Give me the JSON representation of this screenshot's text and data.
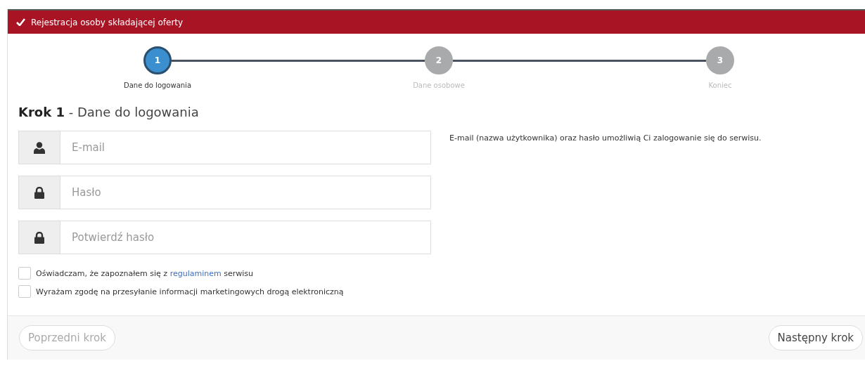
{
  "header": {
    "title": "Rejestracja osoby składającej oferty"
  },
  "steps": [
    {
      "number": "1",
      "label": "Dane do logowania",
      "selected": true
    },
    {
      "number": "2",
      "label": "Dane osobowe",
      "selected": false
    },
    {
      "number": "3",
      "label": "Koniec",
      "selected": false
    }
  ],
  "heading": {
    "step": "Krok 1",
    "title": " - Dane do logowania"
  },
  "fields": [
    {
      "kind": "user",
      "placeholder": "E-mail"
    },
    {
      "kind": "lock",
      "placeholder": "Hasło"
    },
    {
      "kind": "lock",
      "placeholder": "Potwierdź hasło"
    }
  ],
  "help_text": "E-mail (nazwa użytkownika) oraz hasło umożliwią Ci zalogowanie się do serwisu.",
  "consents": [
    {
      "text_before": "Oświadczam, że zapoznałem się z ",
      "link": "regulaminem",
      "text_after": " serwisu",
      "checked": false
    },
    {
      "text_before": "Wyrażam zgodę na przesyłanie informacji marketingowych drogą elektroniczną",
      "checked": false
    }
  ],
  "buttons": [
    {
      "label": "Poprzedni krok",
      "disabled": true
    },
    {
      "label": "Następny krok",
      "disabled": false
    }
  ]
}
